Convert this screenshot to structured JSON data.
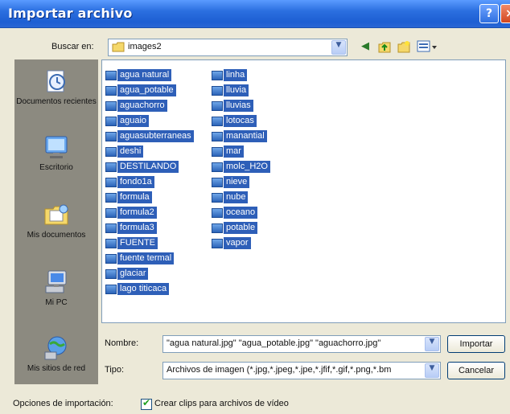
{
  "window": {
    "title": "Importar archivo"
  },
  "lookin": {
    "label": "Buscar en:",
    "value": "images2"
  },
  "places": [
    {
      "label": "Documentos recientes",
      "icon": "recent-documents-icon"
    },
    {
      "label": "Escritorio",
      "icon": "desktop-icon"
    },
    {
      "label": "Mis documentos",
      "icon": "my-documents-icon"
    },
    {
      "label": "Mi PC",
      "icon": "my-computer-icon"
    },
    {
      "label": "Mis sitios de red",
      "icon": "network-places-icon"
    }
  ],
  "files": {
    "column1": [
      "agua natural",
      "agua_potable",
      "aguachorro",
      "aguaio",
      "aguasubterraneas",
      "deshi",
      "DESTILANDO",
      "fondo1a",
      "formula",
      "formula2",
      "formula3",
      "FUENTE",
      "fuente termal",
      "glaciar",
      "lago titicaca"
    ],
    "column2": [
      "linha",
      "lluvia",
      "lluvias",
      "lotocas",
      "manantial",
      "mar",
      "molc_H2O",
      "nieve",
      "nube",
      "oceano",
      "potable",
      "vapor"
    ]
  },
  "filename": {
    "label": "Nombre:",
    "value": "\"agua natural.jpg\" \"agua_potable.jpg\" \"aguachorro.jpg\""
  },
  "filetype": {
    "label": "Tipo:",
    "value": "Archivos de imagen (*.jpg,*.jpeg,*.jpe,*.jfif,*.gif,*.png,*.bm"
  },
  "buttons": {
    "import": "Importar",
    "cancel": "Cancelar"
  },
  "options": {
    "label": "Opciones de importación:",
    "checkbox_label": "Crear clips para archivos de vídeo",
    "checked": true
  }
}
